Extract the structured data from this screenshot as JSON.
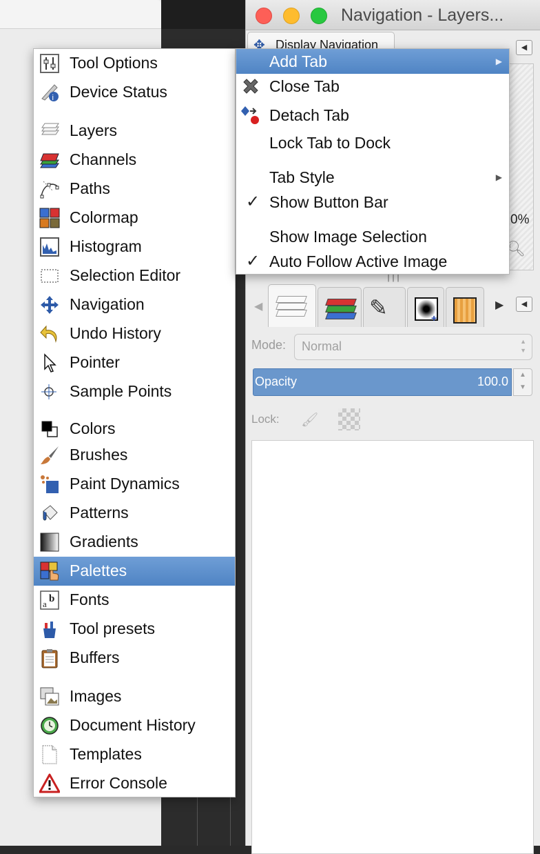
{
  "window": {
    "title": "Navigation - Layers...",
    "display_navigation_tab": "Display Navigation",
    "zoom_percent": "0%"
  },
  "layers_panel": {
    "mode_label": "Mode:",
    "mode_value": "Normal",
    "opacity_label": "Opacity",
    "opacity_value": "100.0",
    "lock_label": "Lock:"
  },
  "menu": {
    "items": [
      {
        "label": "Tool Options",
        "icon": "tool-options-icon"
      },
      {
        "label": "Device Status",
        "icon": "device-status-icon"
      },
      {
        "label": "Layers",
        "icon": "layers-icon"
      },
      {
        "label": "Channels",
        "icon": "channels-icon"
      },
      {
        "label": "Paths",
        "icon": "paths-icon"
      },
      {
        "label": "Colormap",
        "icon": "colormap-icon"
      },
      {
        "label": "Histogram",
        "icon": "histogram-icon"
      },
      {
        "label": "Selection Editor",
        "icon": "selection-editor-icon"
      },
      {
        "label": "Navigation",
        "icon": "navigation-icon"
      },
      {
        "label": "Undo History",
        "icon": "undo-history-icon"
      },
      {
        "label": "Pointer",
        "icon": "pointer-icon"
      },
      {
        "label": "Sample Points",
        "icon": "sample-points-icon"
      },
      {
        "label": "Colors",
        "icon": "colors-icon"
      },
      {
        "label": "Brushes",
        "icon": "brushes-icon"
      },
      {
        "label": "Paint Dynamics",
        "icon": "paint-dynamics-icon"
      },
      {
        "label": "Patterns",
        "icon": "patterns-icon"
      },
      {
        "label": "Gradients",
        "icon": "gradients-icon"
      },
      {
        "label": "Palettes",
        "icon": "palettes-icon",
        "selected": true
      },
      {
        "label": "Fonts",
        "icon": "fonts-icon"
      },
      {
        "label": "Tool presets",
        "icon": "tool-presets-icon"
      },
      {
        "label": "Buffers",
        "icon": "buffers-icon"
      },
      {
        "label": "Images",
        "icon": "images-icon"
      },
      {
        "label": "Document History",
        "icon": "document-history-icon"
      },
      {
        "label": "Templates",
        "icon": "templates-icon"
      },
      {
        "label": "Error Console",
        "icon": "error-console-icon"
      }
    ]
  },
  "submenu": {
    "items": [
      {
        "label": "Add Tab",
        "has_submenu": true,
        "selected": true
      },
      {
        "label": "Close Tab",
        "icon": "close-tab-icon"
      },
      {
        "label": "Detach Tab",
        "icon": "detach-tab-icon"
      },
      {
        "label": "Lock Tab to Dock"
      },
      {
        "label": "Tab Style",
        "has_submenu": true
      },
      {
        "label": "Show Button Bar",
        "checked": true
      },
      {
        "label": "Show Image Selection"
      },
      {
        "label": "Auto Follow Active Image",
        "checked": true
      }
    ]
  }
}
